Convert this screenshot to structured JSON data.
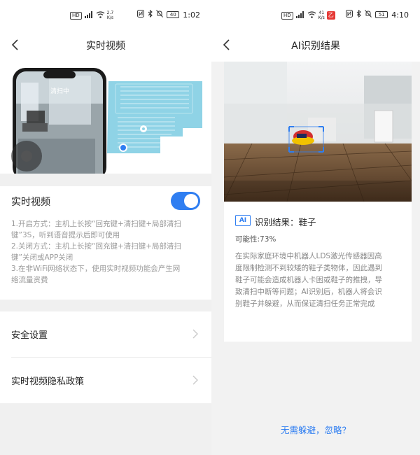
{
  "left": {
    "status": {
      "speed_value": "2.7",
      "speed_unit": "K/s",
      "battery": "40",
      "time": "1:02"
    },
    "nav": {
      "title": "实时视频"
    },
    "hero": {
      "phone_label": "清扫中"
    },
    "realtime": {
      "label": "实时视频",
      "toggle_on": true,
      "desc_lines": [
        "1.开启方式：主机上长按“回充键+清扫键+局部清扫",
        "键”3S，听到语音提示后即可使用",
        "2.关闭方式：主机上长按“回充键+清扫键+局部清扫",
        "键”关闭或APP关闭",
        "3.在非WiFi网络状态下，使用实时视频功能会产生网",
        "络流量资费"
      ]
    },
    "menu": [
      {
        "label": "安全设置"
      },
      {
        "label": "实时视频隐私政策"
      }
    ]
  },
  "right": {
    "status": {
      "speed_value": "41",
      "speed_unit": "K/s",
      "battery": "51",
      "time": "4:10",
      "app_badge": "乙"
    },
    "nav": {
      "title": "AI识别结果"
    },
    "result": {
      "badge": "AI",
      "title": "识别结果：鞋子",
      "probability": "可能性:73%",
      "desc_lines": [
        "在实际家庭环境中机器人LDS激光传感器因高",
        "度限制检测不到较矮的鞋子类物体，因此遇到",
        "鞋子可能会造成机器人卡困或鞋子的推拽，导",
        "致清扫中断等问题；AI识别后，机器人将会识",
        "别鞋子并躲避，从而保证清扫任务正常完成"
      ]
    },
    "ignore_link": "无需躲避，忽略？"
  },
  "colors": {
    "accent": "#2f7ef1",
    "map": "#8fd3e6"
  }
}
